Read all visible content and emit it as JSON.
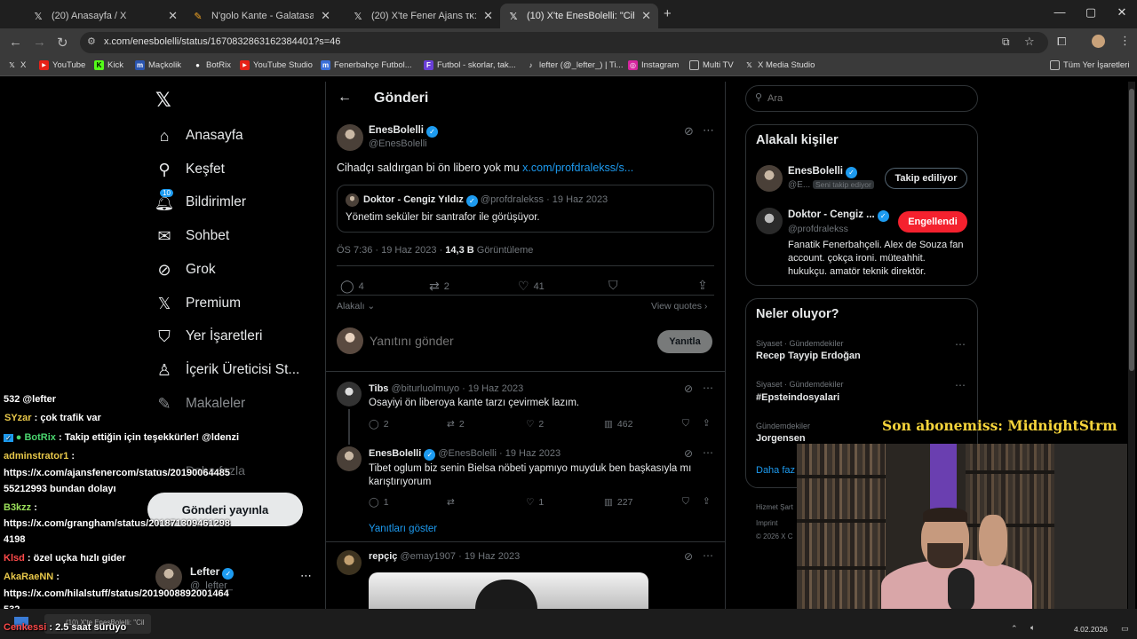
{
  "browser": {
    "tabs": [
      {
        "title": "(20) Anasayfa / X",
        "icon": "x-logo",
        "active": false
      },
      {
        "title": "N'golo Kante - Galatasaray Söz",
        "icon": "pencil-icon",
        "active": false
      },
      {
        "title": "(20) X'te Fener Ajans τκ: \"Ertan",
        "icon": "x-logo",
        "active": false
      },
      {
        "title": "(10) X'te EnesBolelli: \"Cihadçı sa",
        "icon": "x-logo",
        "active": true
      }
    ],
    "url": "x.com/enesbolelli/status/1670832863162384401?s=46",
    "bookmarks": [
      {
        "label": "X",
        "icon": "x-logo"
      },
      {
        "label": "YouTube",
        "icon": "youtube-icon"
      },
      {
        "label": "Kick",
        "icon": "kick-icon"
      },
      {
        "label": "Maçkolik",
        "icon": "mackolik-icon"
      },
      {
        "label": "BotRix",
        "icon": "botrix-icon"
      },
      {
        "label": "YouTube Studio",
        "icon": "youtube-studio-icon"
      },
      {
        "label": "Fenerbahçe Futbol...",
        "icon": "m-icon"
      },
      {
        "label": "Futbol - skorlar, tak...",
        "icon": "flashscore-icon"
      },
      {
        "label": "lefter (@_lefter_) | Ti...",
        "icon": "tiktok-icon"
      },
      {
        "label": "Instagram",
        "icon": "instagram-icon"
      },
      {
        "label": "Multi TV",
        "icon": "document-icon"
      },
      {
        "label": "X Media Studio",
        "icon": "x-logo"
      }
    ],
    "all_bookmarks": "Tüm Yer İşaretleri"
  },
  "sidebar": {
    "items": [
      {
        "label": "Anasayfa",
        "icon": "home-icon"
      },
      {
        "label": "Keşfet",
        "icon": "search-icon"
      },
      {
        "label": "Bildirimler",
        "icon": "bell-icon",
        "badge": "10"
      },
      {
        "label": "Sohbet",
        "icon": "mail-icon"
      },
      {
        "label": "Grok",
        "icon": "grok-icon"
      },
      {
        "label": "Premium",
        "icon": "x-logo"
      },
      {
        "label": "Yer İşaretleri",
        "icon": "bookmark-icon"
      },
      {
        "label": "İçerik Üreticisi St...",
        "icon": "creator-icon"
      },
      {
        "label": "Makaleler",
        "icon": "article-icon"
      },
      {
        "label": "Daha fazla",
        "icon": "more-icon"
      }
    ],
    "post_button": "Gönderi yayınla",
    "account": {
      "name": "Lefter",
      "handle": "@_lefter_"
    }
  },
  "main": {
    "header_title": "Gönderi",
    "post": {
      "name": "EnesBolelli",
      "handle": "@EnesBolelli",
      "text": "Cihadçı saldırgan bi ön libero yok mu ",
      "link": "x.com/profdralekss/s...",
      "quote": {
        "name": "Doktor - Cengiz Yıldız",
        "handle": "@profdralekss",
        "date": "19 Haz 2023",
        "text": "Yönetim seküler bir santrafor ile görüşüyor."
      },
      "time": "ÖS 7:36 · 19 Haz 2023 · ",
      "views": "14,3 B",
      "views_label": " Görüntüleme",
      "replies": "4",
      "reposts": "2",
      "likes": "41",
      "sort_label": "Alakalı",
      "view_quotes": "View quotes"
    },
    "reply_box": {
      "placeholder": "Yanıtını gönder",
      "button": "Yanıtla"
    },
    "replies": [
      {
        "name": "Tibs",
        "handle": "@biturluolmuyo",
        "date": "19 Haz 2023",
        "text": "Osayiyi ön liberoya kante tarzı çevirmek lazım.",
        "replies": "2",
        "reposts": "2",
        "likes": "2",
        "views": "462"
      },
      {
        "name": "EnesBolelli",
        "handle": "@EnesBolelli",
        "date": "19 Haz 2023",
        "text": "Tibet oglum biz senin Bielsa nöbeti yapmıyo muyduk ben başkasıyla mı karıştırıyorum",
        "replies": "1",
        "reposts": "",
        "likes": "1",
        "views": "227"
      },
      {
        "name": "repçiç",
        "handle": "@emay1907",
        "date": "19 Haz 2023"
      }
    ],
    "show_replies": "Yanıtları göster"
  },
  "right": {
    "search_placeholder": "Ara",
    "relevant_title": "Alakalı kişiler",
    "people": [
      {
        "name": "EnesBolelli",
        "handle": "@E...",
        "follows_you": "Seni takip ediyor",
        "button": "Takip ediliyor"
      },
      {
        "name": "Doktor - Cengiz ...",
        "handle": "@profdralekss",
        "button": "Engellendi",
        "bio": "Fanatik Fenerbahçeli. Alex de Souza fan account. çokça ironi. müteahhit. hukukçu. amatör teknik direktör."
      }
    ],
    "trends_title": "Neler oluyor?",
    "trends": [
      {
        "context": "Siyaset · Gündemdekiler",
        "name": "Recep Tayyip Erdoğan"
      },
      {
        "context": "Siyaset · Gündemdekiler",
        "name": "#Epsteindosyalari"
      },
      {
        "context": "Gündemdekiler",
        "name": "Jorgensen"
      }
    ],
    "show_more": "Daha faz",
    "footer": [
      "Hizmet Şart",
      "Imprint",
      "© 2026 X C"
    ]
  },
  "overlay": {
    "subscriber": "Son abonemiss: MidnightStrm",
    "chat": [
      {
        "user": "",
        "text": "532 @lefter",
        "color": "#ffffff"
      },
      {
        "user": "SYzar",
        "text": " : çok trafik var",
        "color": "#e8c84a"
      },
      {
        "user": "BotRix",
        "text": " : Takip ettiğin için teşekkürler! @ldenzi",
        "color": "#4ad46e"
      },
      {
        "user": "adminstrator1",
        "text": " :",
        "color": "#e8c84a"
      },
      {
        "user": "",
        "text": "https://x.com/ajansfenercom/status/20190064485",
        "color": "#ffffff"
      },
      {
        "user": "",
        "text": "55212993 bundan dolayı",
        "color": "#ffffff"
      },
      {
        "user": "B3kzz",
        "text": " :",
        "color": "#9be05a"
      },
      {
        "user": "",
        "text": "https://x.com/grangham/status/201871309461298",
        "color": "#ffffff"
      },
      {
        "user": "",
        "text": "4198",
        "color": "#ffffff"
      },
      {
        "user": "Klsd",
        "text": " : özel uçka hızlı gider",
        "color": "#ff4a4a"
      },
      {
        "user": "AkaRaeNN",
        "text": " :",
        "color": "#e8c84a"
      },
      {
        "user": "",
        "text": "https://x.com/hilalstuff/status/2019008892001464",
        "color": "#ffffff"
      },
      {
        "user": "",
        "text": "532",
        "color": "#ffffff"
      },
      {
        "user": "Cenkessi",
        "text": " : 2.5 saat sürüyo",
        "color": "#ff4a4a"
      }
    ]
  },
  "taskbar": {
    "item": "(10) X'te EnesBolelli: \"Cil",
    "date": "4.02.2026"
  }
}
